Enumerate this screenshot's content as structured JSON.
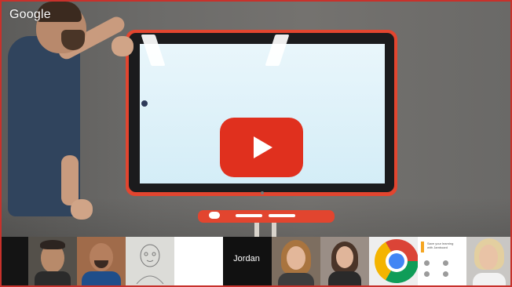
{
  "app": {
    "brand": "Google"
  },
  "player": {
    "play_button": "play",
    "accent_color": "#e0301e"
  },
  "participants": [
    {
      "label": ""
    },
    {
      "label": ""
    },
    {
      "label": ""
    },
    {
      "label": ""
    },
    {
      "label": "Jordan"
    },
    {
      "label": ""
    },
    {
      "label": ""
    },
    {
      "label": ""
    },
    {
      "label": ""
    },
    {
      "label": ""
    }
  ],
  "shared_slide": {
    "title_lines": [
      "Save your learning",
      "with Jamboard"
    ]
  },
  "icons": {
    "play": "play-icon",
    "chrome": "chrome-icon"
  }
}
